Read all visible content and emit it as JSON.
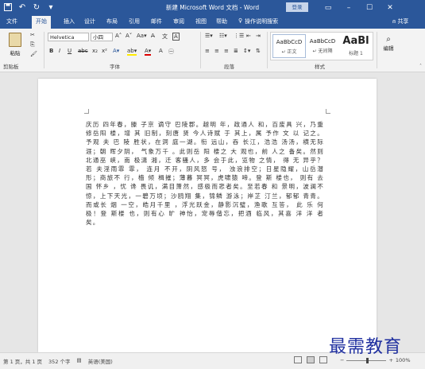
{
  "title_bar": {
    "doc_title": "新建 Microsoft Word 文档 - Word",
    "login": "登录"
  },
  "tabs": [
    "文件",
    "开始",
    "插入",
    "设计",
    "布局",
    "引用",
    "邮件",
    "审阅",
    "视图",
    "帮助"
  ],
  "tell_me": "操作说明搜索",
  "share": "共享",
  "ribbon": {
    "paste": "粘贴",
    "font_name": "Helvetica",
    "font_size": "小四",
    "groups": {
      "clipboard": "剪贴板",
      "font": "字体",
      "paragraph": "段落",
      "styles": "样式"
    },
    "styles": [
      {
        "preview": "AaBbCcD",
        "name": "↵ 正文"
      },
      {
        "preview": "AaBbCcD",
        "name": "↵ 无间隔"
      },
      {
        "preview": "AaBl",
        "name": "标题 1"
      }
    ],
    "editing": "编辑"
  },
  "document": {
    "text": "庆历 四年春，滕 子京 谪守 巴陵郡。越明 年，政通人 和，百废具 兴，乃重修岳阳 楼，增 其 旧制，刻唐 贤 今人诗赋 于 其上，属 予作 文 以 记之。予观 夫 巴 陵 胜状，在洞 庭一湖。衔 远山，吞 长江，浩浩 汤汤，横无际 涯；朝 晖夕阴， 气象万千 。此则岳 阳 楼之 大 观也，前 人之 备矣。然则 北通巫 峡，南 极潇 湘，迁 客骚人，多 会于此，览物 之情， 得 无 异乎？若 夫淫雨霏 霏， 连月 不开，阴风怒 号， 浊浪排空；日星隐耀，山岳潜形；商旅不 行，樯 倾 楫摧；薄暮 冥冥，虎啸猿 啼。登 斯 楼也， 则有 去 国 怀乡 ，忧 谗 畏讥，满目萧然，感极而悲者矣。至若春 和 景明，波澜不惊，上下天光，一碧万顷；沙鸥翔 集，锦鳞 游泳；岸芷 汀兰，郁郁 青青。而或长 烟 一空，皓月千里 ，浮光跃金，静影沉璧，渔歌 互答， 此 乐 何极！登 斯楼 也，则有心 旷 神怡，宠辱偕忘，把酒 临风，其喜 洋 洋 者矣。"
  },
  "status": {
    "page": "第 1 页，共 1 页",
    "words": "352 个字",
    "lang": "英语(美国)",
    "zoom": "100%",
    "zoom_fraction": 0.5
  },
  "watermark": "最需教育"
}
